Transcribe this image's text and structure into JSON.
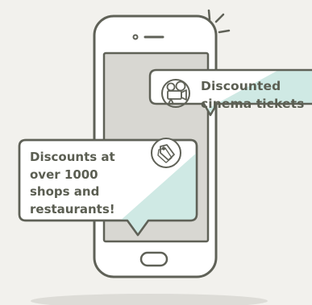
{
  "callouts": {
    "cinema": {
      "lines": [
        "Discounted",
        "cinema tickets"
      ],
      "icon": "film-camera-icon"
    },
    "shops": {
      "lines": [
        "Discounts at",
        "over 1000",
        "shops and",
        "restaurants!"
      ],
      "icon": "price-tag-icon"
    }
  },
  "colors": {
    "background": "#f2f1ed",
    "outline": "#5f6157",
    "phone_body": "#ffffff",
    "phone_screen": "#d8d7d2",
    "bubble_fill": "#ffffff",
    "bubble_accent": "#cfe9e4",
    "text": "#5b5e52",
    "shadow": "#dddcd7"
  }
}
